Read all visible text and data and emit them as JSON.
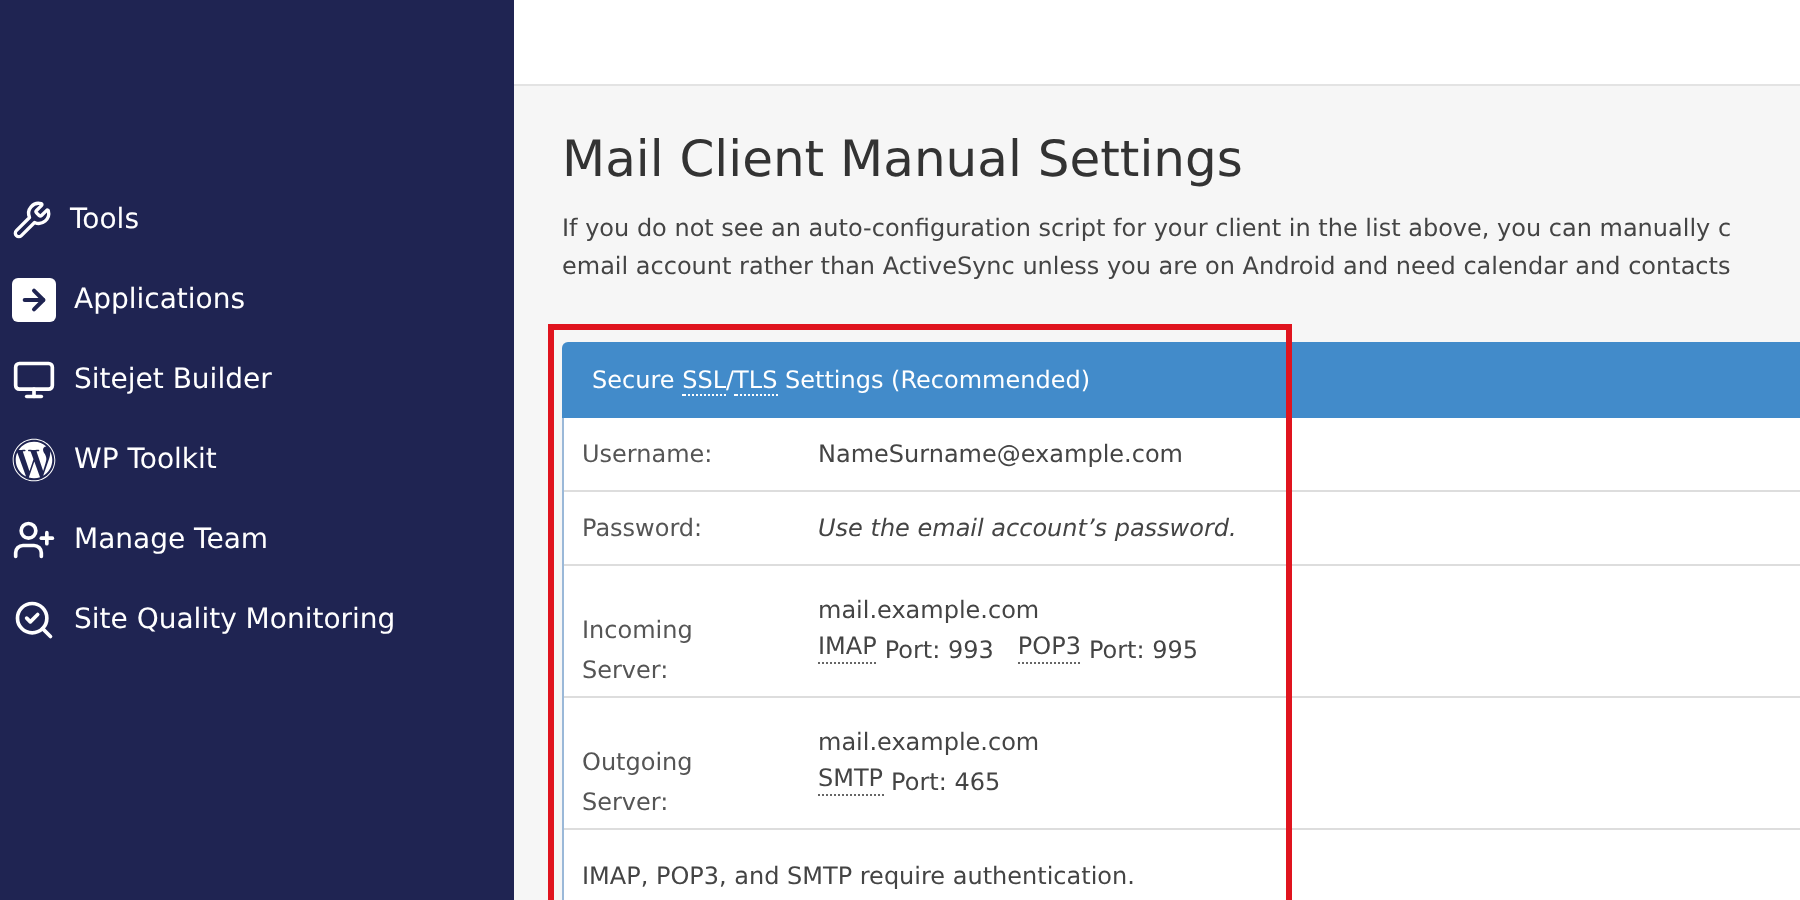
{
  "sidebar": {
    "items": [
      {
        "label": "Tools",
        "kind": "tools"
      },
      {
        "label": "Applications",
        "kind": "applications"
      },
      {
        "label": "Sitejet Builder",
        "kind": "builder"
      },
      {
        "label": "WP Toolkit",
        "kind": "wordpress"
      },
      {
        "label": "Manage Team",
        "kind": "team"
      },
      {
        "label": "Site Quality Monitoring",
        "kind": "quality"
      }
    ]
  },
  "page": {
    "title": "Mail Client Manual Settings",
    "description": [
      "If you do not see an auto-configuration script for your client in the list above, you can manually c",
      "email account rather than ActiveSync unless you are on Android and need calendar and contacts"
    ]
  },
  "settings_table": {
    "highlighted": true,
    "header": [
      {
        "text": "Secure ",
        "abbr": false
      },
      {
        "text": "SSL",
        "abbr": true
      },
      {
        "text": "/",
        "abbr": false
      },
      {
        "text": "TLS",
        "abbr": true
      },
      {
        "text": " Settings (Recommended)",
        "abbr": false
      }
    ],
    "rows": [
      {
        "kind": "plain",
        "label": "Username:",
        "value": "NameSurname@example.com"
      },
      {
        "kind": "italic",
        "label": "Password:",
        "value": "Use the email account’s password."
      },
      {
        "kind": "server",
        "label": "Incoming Server:",
        "host": "mail.example.com",
        "ports": [
          {
            "protocol": "IMAP",
            "text": "Port: 993"
          },
          {
            "protocol": "POP3",
            "text": "Port: 995"
          }
        ]
      },
      {
        "kind": "server",
        "label": "Outgoing Server:",
        "host": "mail.example.com",
        "ports": [
          {
            "protocol": "SMTP",
            "text": "Port: 465"
          }
        ]
      }
    ],
    "footer": "IMAP, POP3, and SMTP require authentication."
  }
}
